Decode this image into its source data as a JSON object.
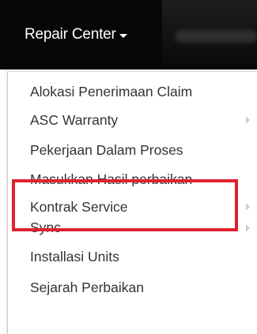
{
  "navbar": {
    "menu_label": "Repair Center"
  },
  "menu": {
    "items": [
      {
        "label": "Alokasi Penerimaan Claim",
        "submenu": false
      },
      {
        "label": "ASC Warranty",
        "submenu": true
      },
      {
        "label": "Pekerjaan Dalam Proses",
        "submenu": false
      },
      {
        "label": "Masukkan Hasil perbaikan",
        "submenu": false
      },
      {
        "label": "Kontrak Service",
        "submenu": true
      },
      {
        "label": "Sync",
        "submenu": true
      },
      {
        "label": "Installasi Units",
        "submenu": false
      },
      {
        "label": "Sejarah Perbaikan",
        "submenu": false
      }
    ]
  },
  "annotation": {
    "highlight_color": "#e0222d"
  }
}
